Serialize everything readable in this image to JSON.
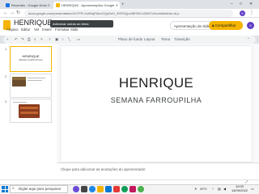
{
  "browser": {
    "tabs": [
      {
        "title": "Recentes - Google Drive",
        "fav_color": "#1a73e8"
      },
      {
        "title": "HENRIQUE - Apresentações Google",
        "fav_color": "#f4b400"
      }
    ],
    "new_tab": "+",
    "url": "docs.google.com/presentation/d/17PR-Xu9hkjFAkoGQpSeH_3SPKQpzI8E9SCo5WS7c5c/edit#slide=id.p",
    "nav": {
      "back": "←",
      "forward": "→",
      "reload": "↻"
    },
    "profile_letter": "S",
    "window": {
      "min": "–",
      "max": "□",
      "close": "✕"
    }
  },
  "app": {
    "doc_title": "HENRIQUE",
    "title_icons": [
      "☆",
      "⊡",
      "☁"
    ],
    "menu": [
      "Arquivo",
      "Editar",
      "Ver",
      "Inserir",
      "Formatar",
      "Slide"
    ],
    "presenter_button": "Apresentação de slides",
    "share_button": "Compartilhar",
    "user_letter": "S",
    "toolbar": {
      "add": "+",
      "undo": "↶",
      "redo": "↷",
      "print": "⎙",
      "zoom": "⌕",
      "select": "↖",
      "background": "Plano de fundo",
      "layout": "Layout",
      "theme": "Tema",
      "transition": "Transição"
    },
    "tooltip": "Adicionar outras ao tema"
  },
  "slides": [
    {
      "number": "1",
      "title": "HENRIQUE",
      "subtitle": "SEMANA FARROUPILHA"
    },
    {
      "number": "2"
    },
    {
      "number": "3"
    }
  ],
  "main_slide": {
    "title": "HENRIQUE",
    "subtitle": "SEMANA  FARROUPILHA"
  },
  "notes_placeholder": "Clique para adicionar as anotações do apresentador",
  "taskbar": {
    "search_placeholder": "Digite aqui para pesquisar",
    "weather": "29°C",
    "time": "10:00",
    "date": "14/09/2022"
  }
}
